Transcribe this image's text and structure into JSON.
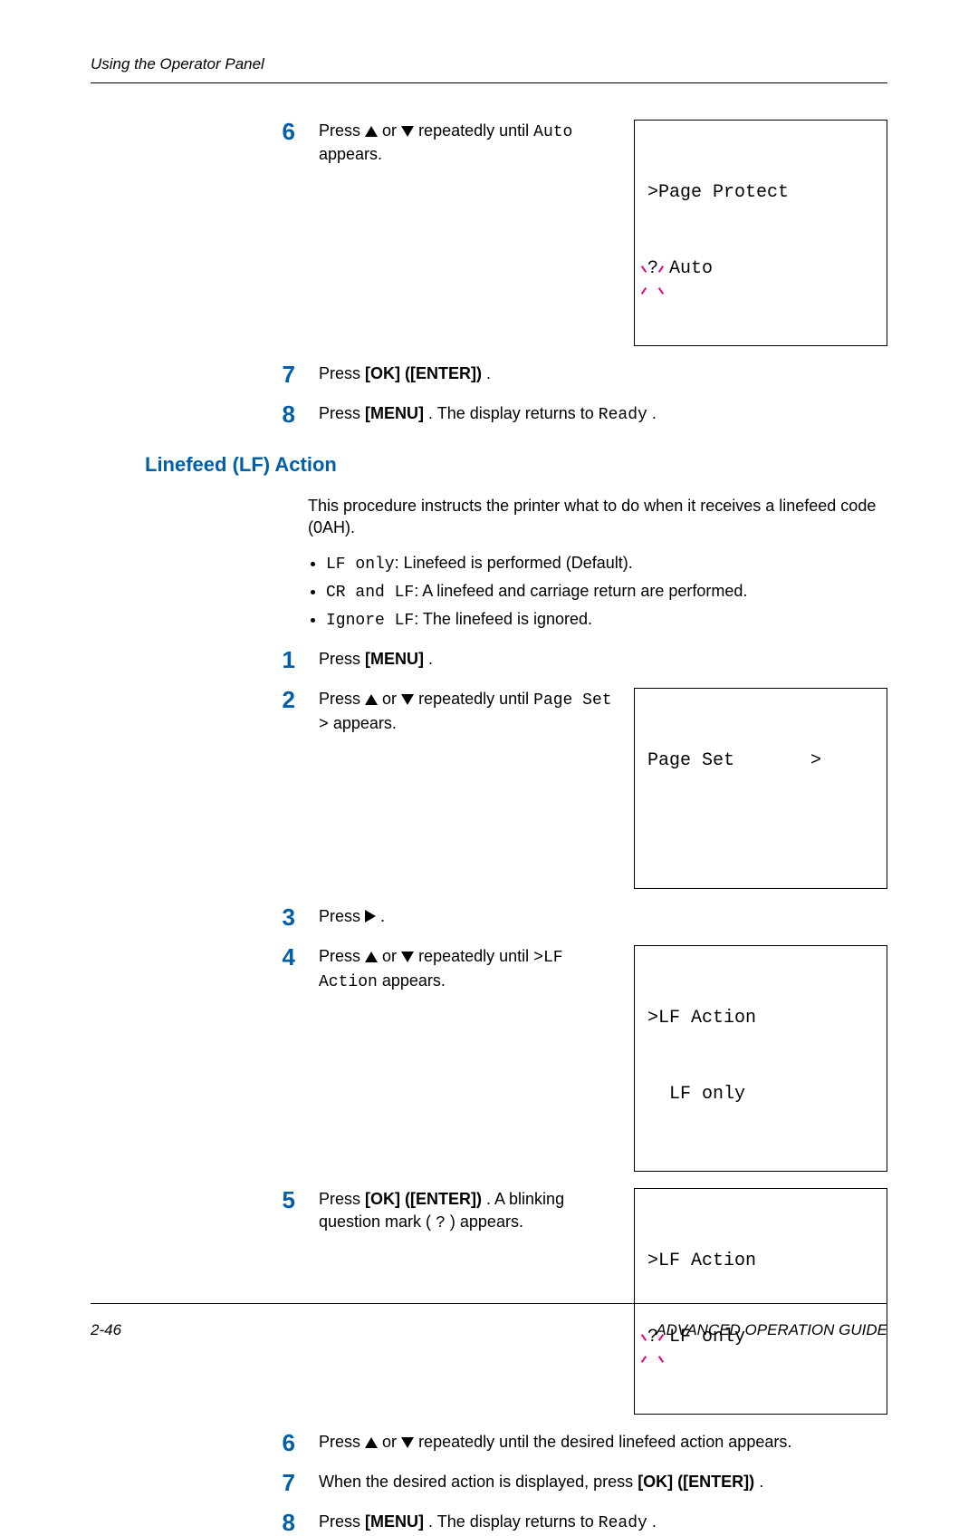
{
  "header": {
    "running": "Using the Operator Panel"
  },
  "displays": {
    "page_protect": {
      "line1": ">Page Protect",
      "line2": "? Auto"
    },
    "page_set": {
      "line1": "Page Set       >",
      "line2": ""
    },
    "lf_action": {
      "line1": ">LF Action",
      "line2": "  LF only"
    },
    "lf_action_q": {
      "line1": ">LF Action",
      "line2": "? LF only"
    }
  },
  "cont_steps": {
    "s6": {
      "num": "6",
      "pre": "Press ",
      "mid": " or ",
      "post_a": " repeatedly until ",
      "mono": "Auto",
      "post_b": " appears."
    },
    "s7": {
      "num": "7",
      "pre": "Press ",
      "bold": "[OK] ([ENTER])",
      "post": "."
    },
    "s8": {
      "num": "8",
      "pre": "Press ",
      "bold": "[MENU]",
      "mid": ". The display returns to ",
      "mono": "Ready",
      "post": "."
    }
  },
  "section": {
    "heading": "Linefeed (LF) Action",
    "intro": "This procedure instructs the printer what to do when it receives a linefeed code (0AH).",
    "bullets": [
      {
        "mono": "LF only",
        "text": ": Linefeed is performed (Default)."
      },
      {
        "mono": "CR and LF",
        "text": ": A linefeed and carriage return are performed."
      },
      {
        "mono": "Ignore LF",
        "text": ": The linefeed is ignored."
      }
    ],
    "s1": {
      "num": "1",
      "pre": "Press ",
      "bold": "[MENU]",
      "post": "."
    },
    "s2": {
      "num": "2",
      "pre": "Press ",
      "mid": " or ",
      "post_a": " repeatedly until ",
      "mono": "Page Set >",
      "post_b": " appears."
    },
    "s3": {
      "num": "3",
      "pre": "Press ",
      "post": "."
    },
    "s4": {
      "num": "4",
      "pre": "Press ",
      "mid": " or ",
      "post_a": " repeatedly until ",
      "mono": ">LF Action",
      "post_b": " appears."
    },
    "s5": {
      "num": "5",
      "pre": "Press ",
      "bold": "[OK] ([ENTER])",
      "mid": ". A blinking question mark (",
      "mono": "?",
      "post": ") appears."
    },
    "s6": {
      "num": "6",
      "pre": "Press ",
      "mid": " or ",
      "post": " repeatedly until the desired linefeed action appears."
    },
    "s7": {
      "num": "7",
      "pre": "When the desired action is displayed, press ",
      "bold": "[OK] ([ENTER])",
      "post": "."
    },
    "s8": {
      "num": "8",
      "pre": "Press ",
      "bold": "[MENU]",
      "mid": ". The display returns to ",
      "mono": "Ready",
      "post": "."
    }
  },
  "footer": {
    "left": "2-46",
    "right": "ADVANCED OPERATION GUIDE"
  }
}
